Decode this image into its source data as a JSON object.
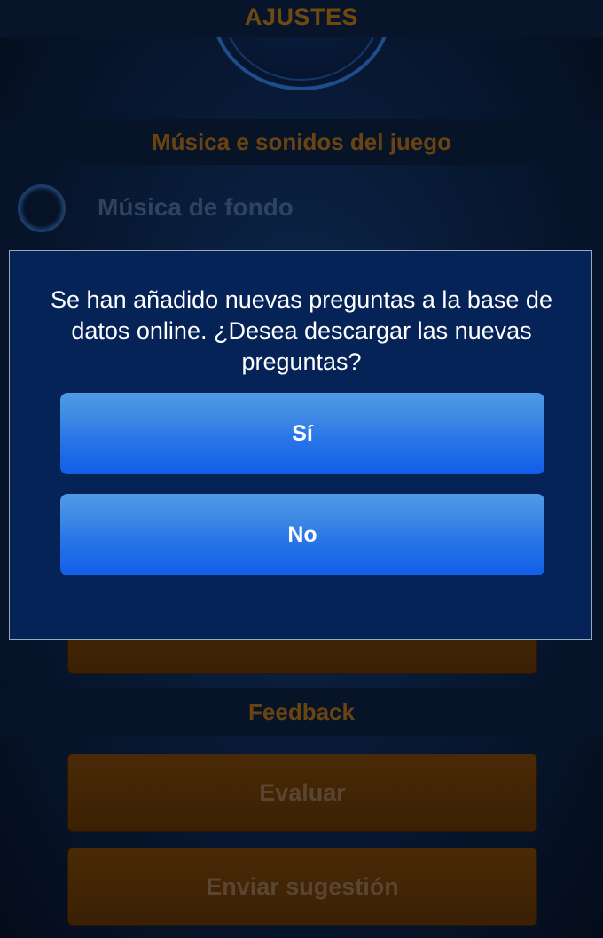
{
  "header": {
    "title": "AJUSTES"
  },
  "sections": {
    "sound": {
      "label": "Música e sonidos del juego",
      "background_music_label": "Música de fondo"
    },
    "feedback": {
      "label": "Feedback",
      "rate_label": "Evaluar",
      "suggest_label": "Enviar sugestión"
    }
  },
  "dialog": {
    "message": "Se han añadido nuevas preguntas a la base de datos online. ¿Desea descargar las nuevas preguntas?",
    "yes_label": "Sí",
    "no_label": "No"
  },
  "colors": {
    "dialog_bg": "#062357",
    "button_blue": "#1a66e8",
    "muted_orange": "#6a4410"
  }
}
